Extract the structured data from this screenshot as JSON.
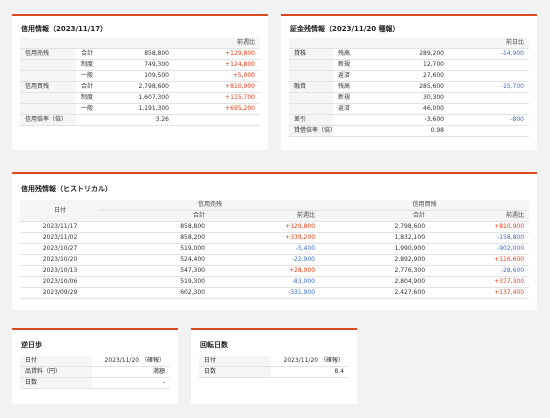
{
  "credit_info": {
    "title": "信用情報（2023/11/17）",
    "header": {
      "col": "前週比"
    },
    "rows": [
      {
        "group": "信用売残",
        "label": "合計",
        "value": "858,800",
        "change": "+129,800",
        "sign": "pos"
      },
      {
        "group": "",
        "label": "制度",
        "value": "749,300",
        "change": "+124,800",
        "sign": "pos"
      },
      {
        "group": "",
        "label": "一般",
        "value": "109,500",
        "change": "+5,000",
        "sign": "pos"
      },
      {
        "group": "信用買残",
        "label": "合計",
        "value": "2,798,600",
        "change": "+810,900",
        "sign": "pos"
      },
      {
        "group": "",
        "label": "制度",
        "value": "1,607,300",
        "change": "+115,700",
        "sign": "pos"
      },
      {
        "group": "",
        "label": "一般",
        "value": "1,191,300",
        "change": "+695,200",
        "sign": "pos"
      },
      {
        "group": "信用倍率（倍）",
        "label": "",
        "value": "3.26",
        "change": "",
        "sign": "zero"
      }
    ]
  },
  "margin_info": {
    "title": "証金残情報（2023/11/20 種報）",
    "header": {
      "col": "前日比"
    },
    "rows": [
      {
        "group": "貸株",
        "label": "残高",
        "value": "289,200",
        "change": "-14,900",
        "sign": "neg"
      },
      {
        "group": "",
        "label": "新規",
        "value": "12,700",
        "change": "",
        "sign": "zero"
      },
      {
        "group": "",
        "label": "返済",
        "value": "27,600",
        "change": "",
        "sign": "zero"
      },
      {
        "group": "融資",
        "label": "残高",
        "value": "285,600",
        "change": "-15,700",
        "sign": "neg"
      },
      {
        "group": "",
        "label": "新規",
        "value": "30,300",
        "change": "",
        "sign": "zero"
      },
      {
        "group": "",
        "label": "返済",
        "value": "46,000",
        "change": "",
        "sign": "zero"
      },
      {
        "group": "差引",
        "label": "",
        "value": "-3,600",
        "change": "-800",
        "sign": "neg"
      },
      {
        "group": "貸借倍率（倍）",
        "label": "",
        "value": "0.98",
        "change": "",
        "sign": "zero"
      }
    ]
  },
  "historical": {
    "title": "信用残情報（ヒストリカル）",
    "col_date": "日付",
    "group_sell": "信用売残",
    "group_buy": "信用買残",
    "col_total": "合計",
    "col_change": "前週比",
    "rows": [
      {
        "date": "2023/11/17",
        "sell": "858,800",
        "sell_chg": "+129,800",
        "sell_sign": "pos",
        "buy": "2,798,600",
        "buy_chg": "+810,900",
        "buy_sign": "pos"
      },
      {
        "date": "2023/11/02",
        "sell": "858,200",
        "sell_chg": "+339,200",
        "sell_sign": "pos",
        "buy": "1,832,100",
        "buy_chg": "-158,800",
        "buy_sign": "neg"
      },
      {
        "date": "2023/10/27",
        "sell": "519,000",
        "sell_chg": "-5,400",
        "sell_sign": "neg",
        "buy": "1,990,900",
        "buy_chg": "-902,000",
        "buy_sign": "neg"
      },
      {
        "date": "2023/10/20",
        "sell": "524,400",
        "sell_chg": "-22,900",
        "sell_sign": "neg",
        "buy": "2,892,900",
        "buy_chg": "+116,600",
        "buy_sign": "pos"
      },
      {
        "date": "2023/10/13",
        "sell": "547,300",
        "sell_chg": "+28,000",
        "sell_sign": "pos",
        "buy": "2,776,300",
        "buy_chg": "-28,600",
        "buy_sign": "neg"
      },
      {
        "date": "2023/10/06",
        "sell": "519,300",
        "sell_chg": "-83,000",
        "sell_sign": "neg",
        "buy": "2,804,900",
        "buy_chg": "+377,300",
        "buy_sign": "pos"
      },
      {
        "date": "2023/09/29",
        "sell": "602,300",
        "sell_chg": "-331,900",
        "sell_sign": "neg",
        "buy": "2,427,600",
        "buy_chg": "+137,400",
        "buy_sign": "pos"
      }
    ]
  },
  "gyakuhibu": {
    "title": "逆日歩",
    "rows": [
      {
        "label": "日付",
        "value": "2023/11/20 （確報）"
      },
      {
        "label": "品貸料（円）",
        "value": "満額"
      },
      {
        "label": "日数",
        "value": "-"
      }
    ]
  },
  "kaiten": {
    "title": "回転日数",
    "rows": [
      {
        "label": "日付",
        "value": "2023/11/20 （確報）"
      },
      {
        "label": "日数",
        "value": "8.4"
      }
    ]
  }
}
